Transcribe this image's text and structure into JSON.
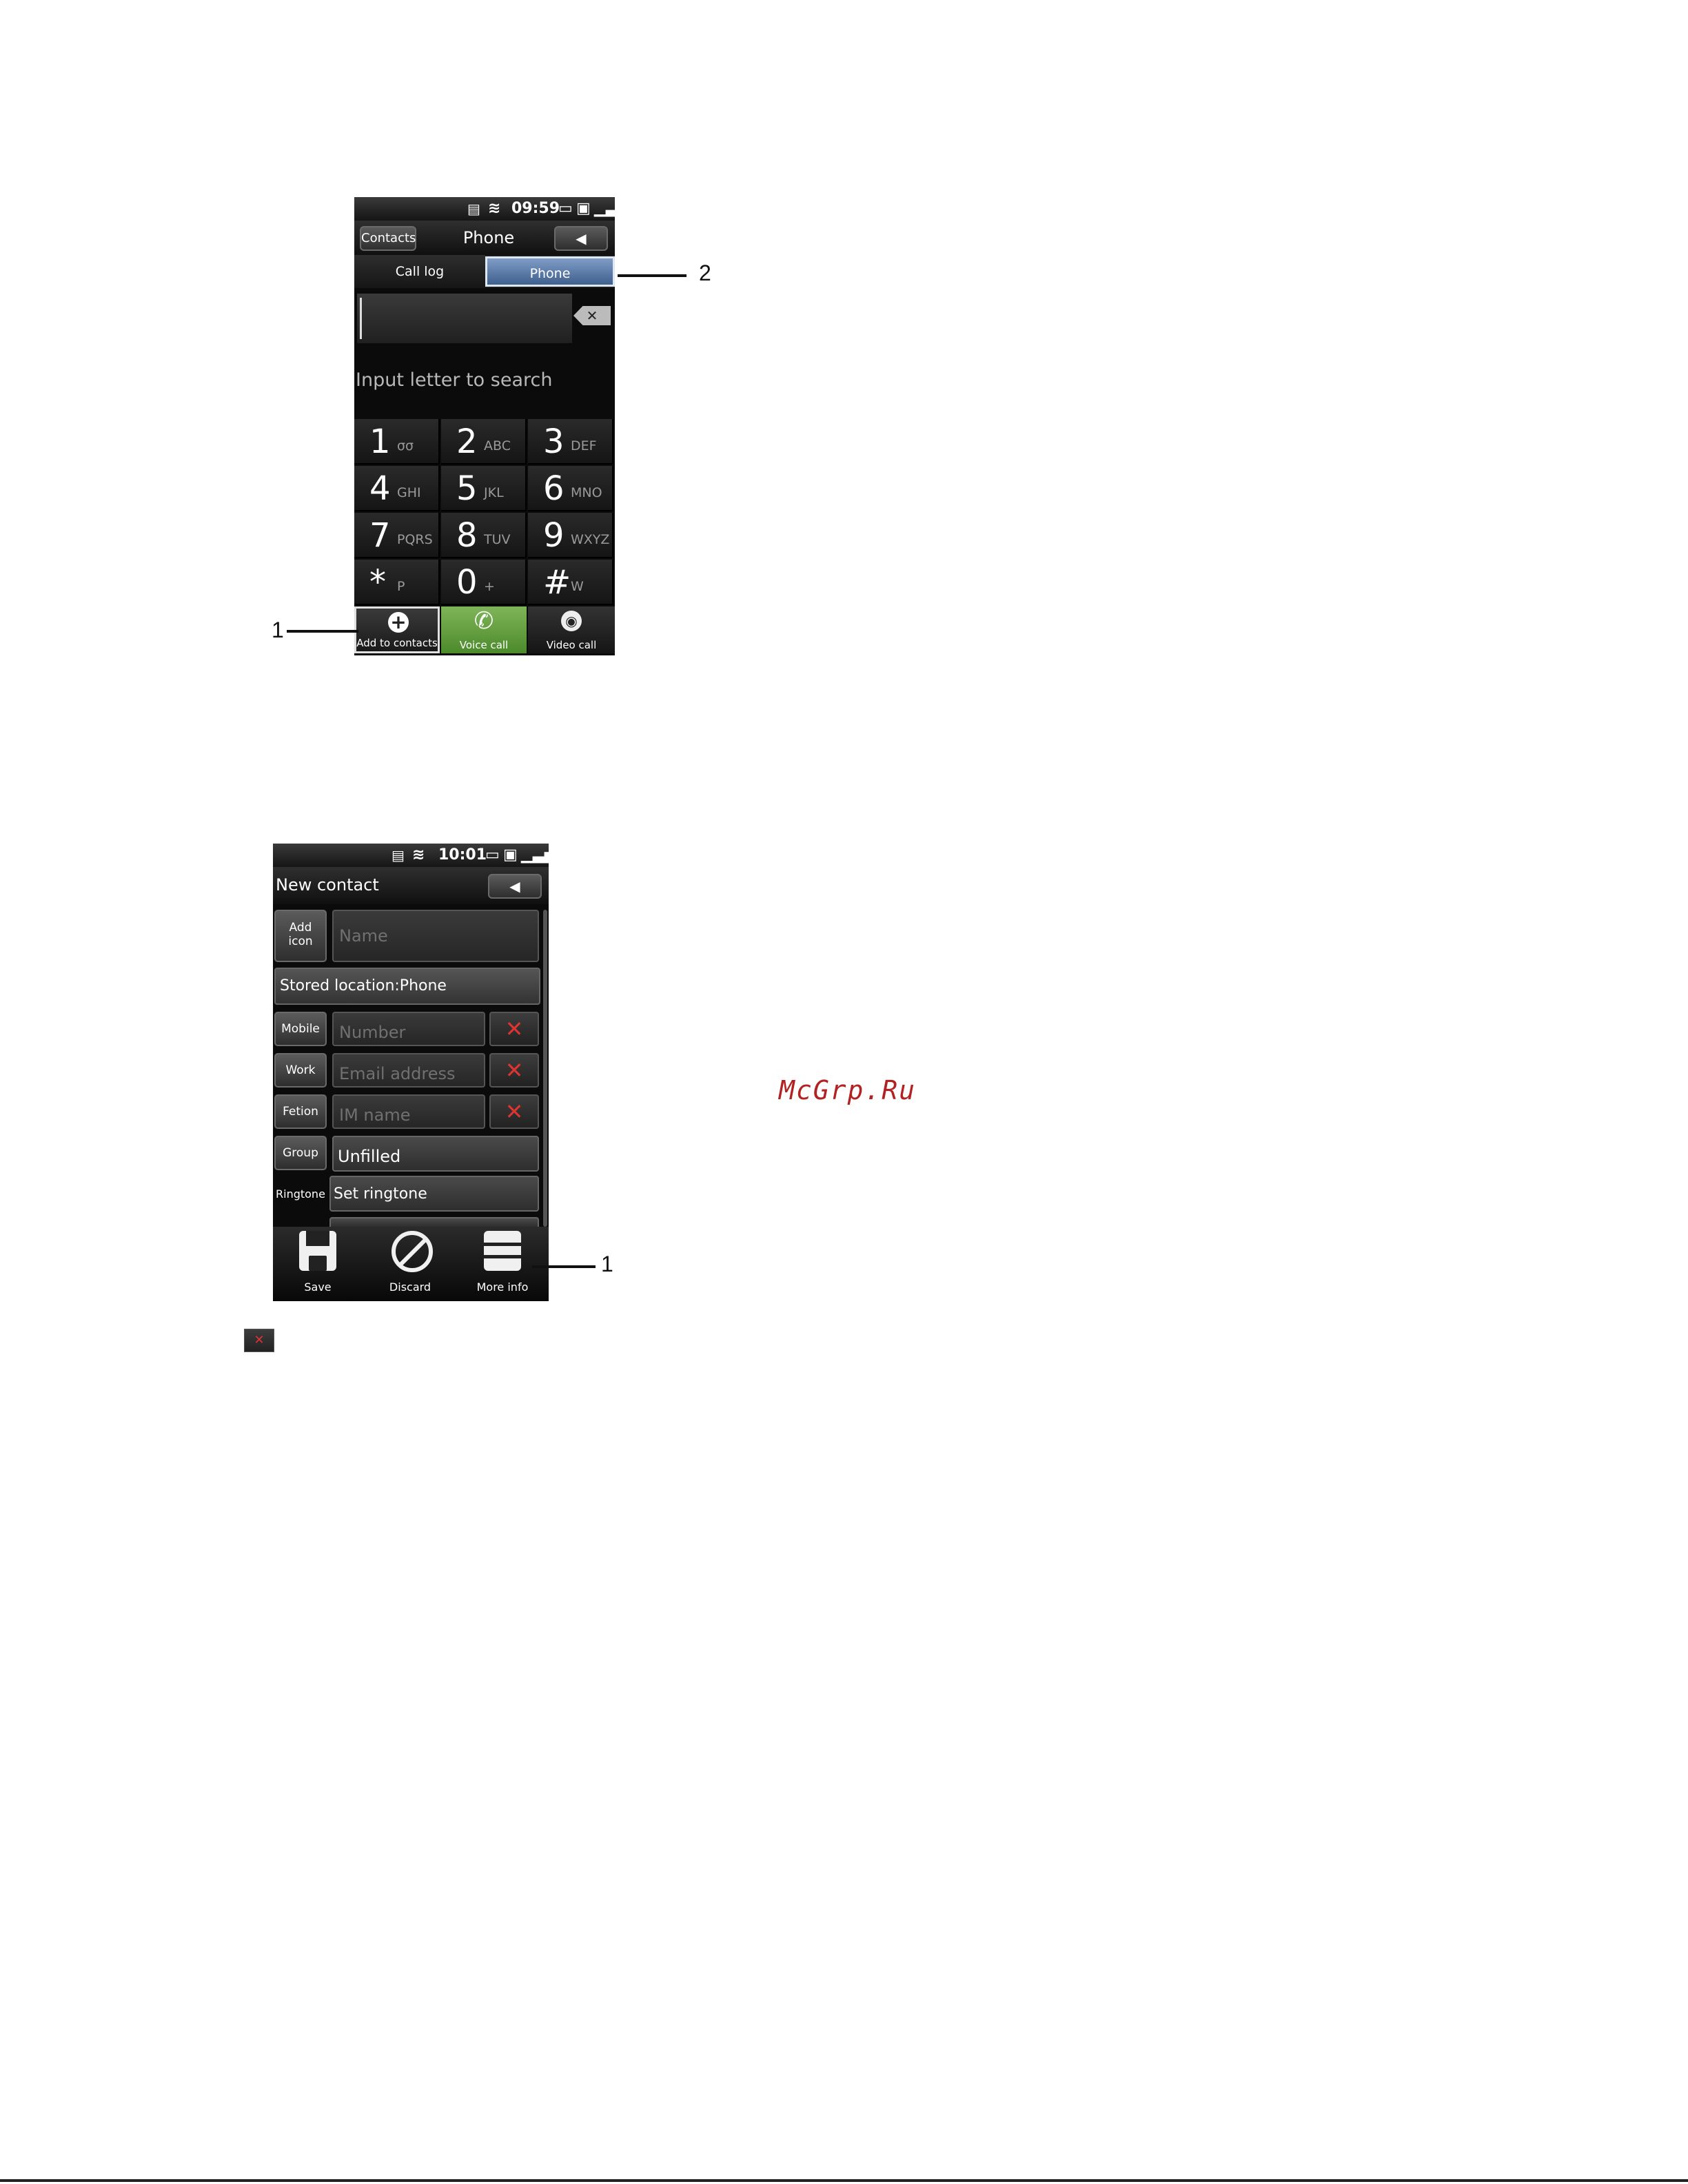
{
  "dialer_screen": {
    "status_time": "09:59",
    "contacts_button": "Contacts",
    "title": "Phone",
    "tabs": [
      "Call log",
      "Phone"
    ],
    "search_hint": "Input letter to search",
    "keys": [
      {
        "digit": "1",
        "letters": "σσ"
      },
      {
        "digit": "2",
        "letters": "ABC"
      },
      {
        "digit": "3",
        "letters": "DEF"
      },
      {
        "digit": "4",
        "letters": "GHI"
      },
      {
        "digit": "5",
        "letters": "JKL"
      },
      {
        "digit": "6",
        "letters": "MNO"
      },
      {
        "digit": "7",
        "letters": "PQRS"
      },
      {
        "digit": "8",
        "letters": "TUV"
      },
      {
        "digit": "9",
        "letters": "WXYZ"
      },
      {
        "digit": "*",
        "letters": "P"
      },
      {
        "digit": "0",
        "letters": "+"
      },
      {
        "digit": "#",
        "letters": "W"
      }
    ],
    "actions": [
      "Add to contacts",
      "Voice call",
      "Video call"
    ],
    "callouts": [
      "1",
      "2"
    ]
  },
  "contact_screen": {
    "status_time": "10:01",
    "title": "New contact",
    "add_icon_label": "Add icon",
    "name_placeholder": "Name",
    "stored_location": "Stored location:Phone",
    "rows": [
      {
        "label": "Mobile",
        "placeholder": "Number"
      },
      {
        "label": "Work",
        "placeholder": "Email address"
      },
      {
        "label": "Fetion",
        "placeholder": "IM name"
      }
    ],
    "group_label": "Group",
    "group_value": "Unfilled",
    "ringtone_label": "Ringtone",
    "ringtone_value": "Set ringtone",
    "toolbar": [
      "Save",
      "Discard",
      "More info"
    ],
    "callout": "1"
  },
  "watermark": "McGrp.Ru",
  "colors": {
    "accent_blue": "#5a7fb0",
    "voice_green": "#5f9a3a",
    "delete_red": "#d33333",
    "watermark_red": "#b22222"
  }
}
